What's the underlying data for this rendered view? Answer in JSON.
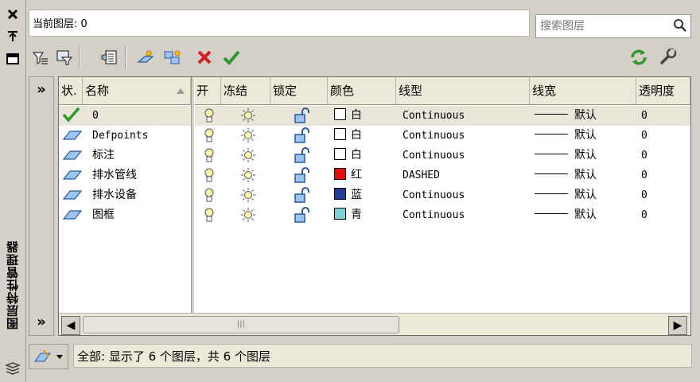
{
  "palette": {
    "title": "图层特性管理器"
  },
  "current_layer": {
    "label": "当前图层: 0"
  },
  "search": {
    "placeholder": "搜索图层"
  },
  "toolbar": {
    "icons": [
      "new-property-filter-icon",
      "new-group-filter-icon",
      "layer-states-manager-icon",
      "new-layer-icon",
      "new-layer-vp-frozen-icon",
      "delete-layer-icon",
      "set-current-icon",
      "refresh-icon",
      "settings-icon"
    ]
  },
  "columns": {
    "status": "状.",
    "name": "名称",
    "on": "开",
    "freeze": "冻结",
    "lock": "锁定",
    "color": "颜色",
    "linetype": "线型",
    "lineweight": "线宽",
    "transparency": "透明度"
  },
  "layers": [
    {
      "name": "0",
      "color_name": "白",
      "color": "#ffffff",
      "linetype": "Continuous",
      "lineweight": "默认",
      "transparency": "0",
      "current": true
    },
    {
      "name": "Defpoints",
      "color_name": "白",
      "color": "#ffffff",
      "linetype": "Continuous",
      "lineweight": "默认",
      "transparency": "0",
      "current": false
    },
    {
      "name": "标注",
      "color_name": "白",
      "color": "#ffffff",
      "linetype": "Continuous",
      "lineweight": "默认",
      "transparency": "0",
      "current": false
    },
    {
      "name": "排水管线",
      "color_name": "红",
      "color": "#e01010",
      "linetype": "DASHED",
      "lineweight": "默认",
      "transparency": "0",
      "current": false
    },
    {
      "name": "排水设备",
      "color_name": "蓝",
      "color": "#203c94",
      "linetype": "Continuous",
      "lineweight": "默认",
      "transparency": "0",
      "current": false
    },
    {
      "name": "图框",
      "color_name": "青",
      "color": "#7fd0d0",
      "linetype": "Continuous",
      "lineweight": "默认",
      "transparency": "0",
      "current": false
    }
  ],
  "status": {
    "text": "全部: 显示了 6 个图层，共 6 个图层"
  }
}
